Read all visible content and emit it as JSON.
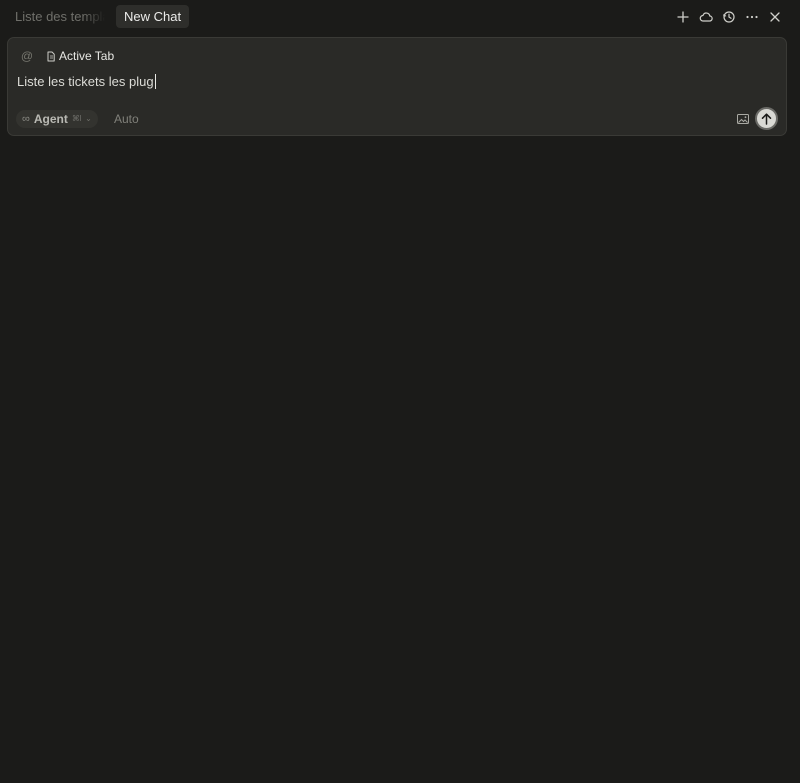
{
  "tabs": [
    {
      "label": "Liste des templates",
      "active": false
    },
    {
      "label": "New Chat",
      "active": true
    }
  ],
  "header_actions": [
    {
      "name": "new-chat",
      "icon": "plus-icon"
    },
    {
      "name": "cloud",
      "icon": "cloud-icon"
    },
    {
      "name": "history",
      "icon": "history-icon"
    },
    {
      "name": "more",
      "icon": "ellipsis-icon"
    },
    {
      "name": "close",
      "icon": "close-icon"
    }
  ],
  "composer": {
    "mention_symbol": "@",
    "context_label": "Active Tab",
    "input_text": "Liste les tickets les plug",
    "mode": {
      "icon": "∞",
      "label": "Agent",
      "shortcut": "⌘I",
      "chevron": "⌄"
    },
    "model_label": "Auto"
  },
  "colors": {
    "background": "#1b1b19",
    "composer_bg": "#2a2a27",
    "active_tab_bg": "#2e2e2b",
    "send_button_bg": "#d9d9d4"
  }
}
